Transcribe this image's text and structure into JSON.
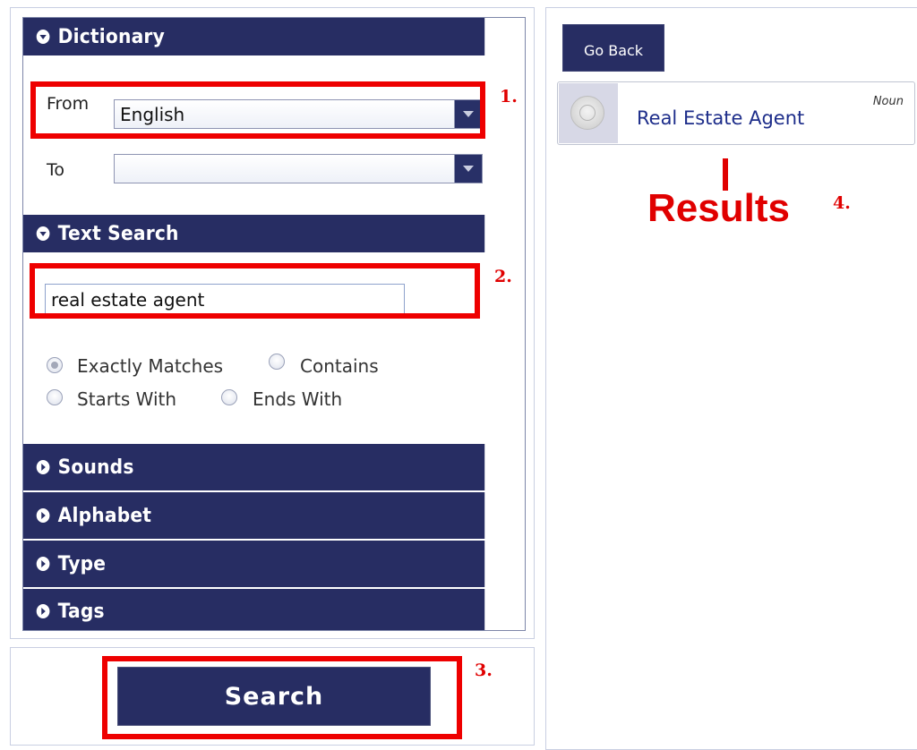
{
  "left": {
    "dictionary": {
      "header": "Dictionary",
      "from_label": "From",
      "from_value": "English",
      "to_label": "To",
      "to_value": ""
    },
    "text_search": {
      "header": "Text Search",
      "query": "real estate agent",
      "options": [
        {
          "label": "Exactly Matches",
          "checked": true
        },
        {
          "label": "Contains",
          "checked": false
        },
        {
          "label": "Starts With",
          "checked": false
        },
        {
          "label": "Ends With",
          "checked": false
        }
      ]
    },
    "sections": [
      "Sounds",
      "Alphabet",
      "Type",
      "Tags"
    ],
    "search_button": "Search"
  },
  "right": {
    "go_back": "Go Back",
    "result": {
      "title": "Real Estate Agent",
      "part_of_speech": "Noun"
    }
  },
  "annotations": {
    "step1": "1.",
    "step2": "2.",
    "step3": "3.",
    "step4": "4.",
    "results_label": "Results"
  },
  "colors": {
    "accent_navy": "#272d63",
    "annotation_red": "#ee0000",
    "result_link": "#1d2d8a"
  }
}
